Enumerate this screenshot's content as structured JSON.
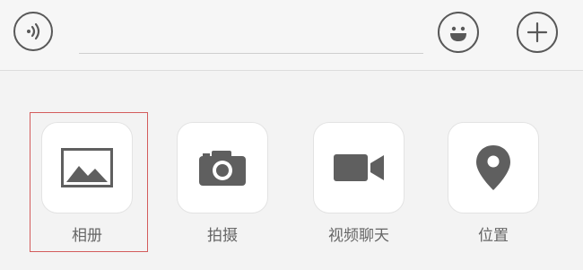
{
  "input_bar": {
    "voice_icon": "voice-wave-icon",
    "emoji_icon": "smiley-face-icon",
    "plus_icon": "plus-icon",
    "text_value": ""
  },
  "panel": {
    "items": [
      {
        "label": "相册",
        "icon": "image-gallery-icon"
      },
      {
        "label": "拍摄",
        "icon": "camera-icon"
      },
      {
        "label": "视频聊天",
        "icon": "video-camera-icon"
      },
      {
        "label": "位置",
        "icon": "location-pin-icon"
      }
    ]
  },
  "colors": {
    "icon": "#5f5f5f",
    "label": "#666666",
    "highlight_border": "#d35c5c",
    "background": "#f5f5f5"
  }
}
